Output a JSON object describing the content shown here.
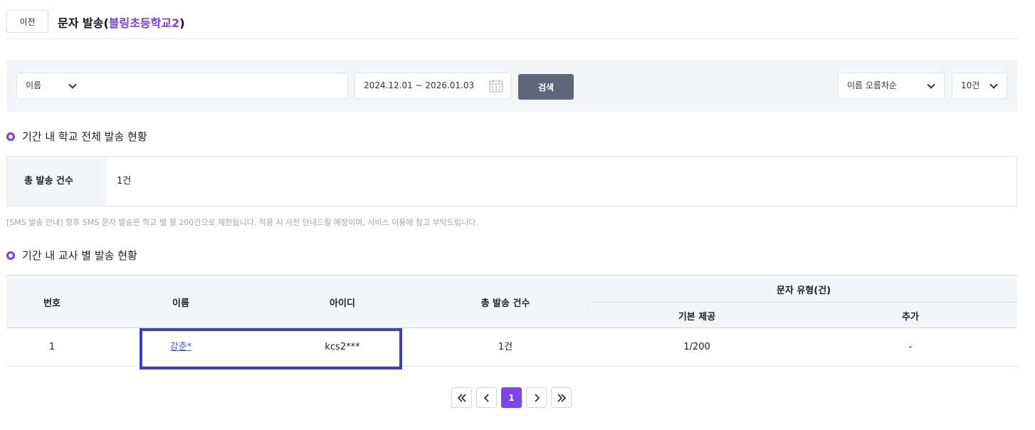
{
  "header": {
    "back_label": "이전",
    "title_prefix": "문자 발송(",
    "school_name": "블링초등학교2",
    "title_suffix": ")"
  },
  "filter": {
    "search_type": "이름",
    "search_value": "",
    "date_range": "2024.12.01 ~ 2026.01.03",
    "search_button": "검색",
    "sort": "이름 오름차순",
    "page_size": "10건"
  },
  "school_summary": {
    "title": "기간 내 학교 전체 발송 현황",
    "label": "총 발송 건수",
    "value": "1건"
  },
  "notice": "[SMS 발송 안내] 향후 SMS 문자 발송은 학교 별 월 200건으로 제한됩니다. 적용 시 사전 안내드릴 예정이며, 서비스 이용에 참고 부탁드립니다.",
  "teacher_table": {
    "title": "기간 내 교사 별 발송 현황",
    "headers": {
      "no": "번호",
      "name": "이름",
      "id": "아이디",
      "total": "총 발송 건수",
      "type_group": "문자 유형(건)",
      "basic": "기본 제공",
      "extra": "추가"
    },
    "rows": [
      {
        "no": "1",
        "name": "강춘*",
        "id": "kcs2***",
        "total": "1건",
        "basic": "1/200",
        "extra": "-"
      }
    ]
  },
  "pagination": {
    "current": "1"
  },
  "colors": {
    "accent": "#7b47ea",
    "button_gray": "#5e6677",
    "link": "#3d63c9",
    "highlight": "#3d3fc0"
  }
}
